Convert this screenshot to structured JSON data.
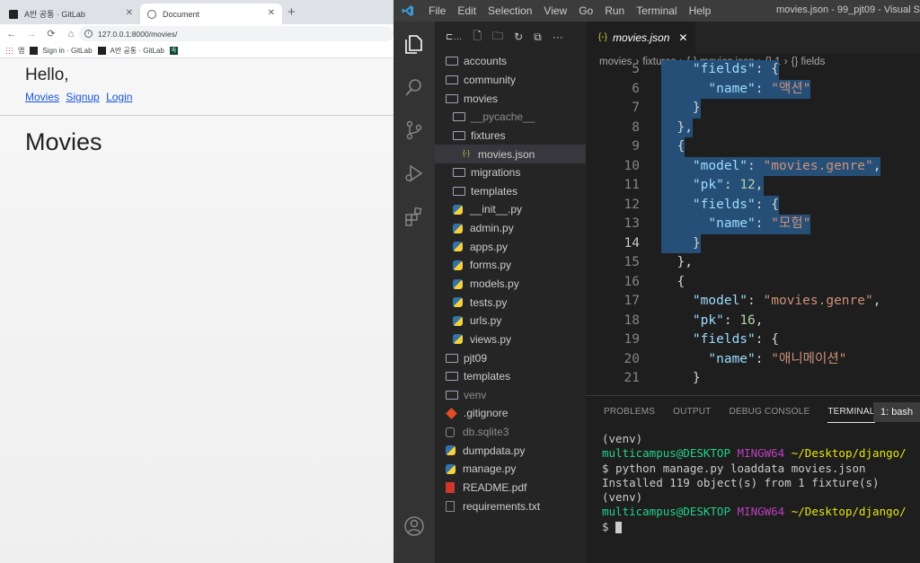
{
  "browser": {
    "tabs": [
      {
        "title": "A반 공통 · GitLab"
      },
      {
        "title": "Document"
      }
    ],
    "url": "127.0.0.1:8000/movies/",
    "bookmarks": [
      "앱",
      "Sign in · GitLab",
      "A반 공통 · GitLab",
      "dj"
    ],
    "page": {
      "greeting": "Hello,",
      "links": [
        "Movies",
        "Signup",
        "Login"
      ],
      "heading": "Movies"
    }
  },
  "vscode": {
    "menu": [
      "File",
      "Edit",
      "Selection",
      "View",
      "Go",
      "Run",
      "Terminal",
      "Help"
    ],
    "window_title": "movies.json - 99_pjt09 - Visual S",
    "explorer": [
      {
        "name": "accounts",
        "type": "folder",
        "indent": 0
      },
      {
        "name": "community",
        "type": "folder",
        "indent": 0
      },
      {
        "name": "movies",
        "type": "folder",
        "indent": 0
      },
      {
        "name": "__pycache__",
        "type": "folder",
        "indent": 1,
        "dim": true
      },
      {
        "name": "fixtures",
        "type": "folder",
        "indent": 1
      },
      {
        "name": "movies.json",
        "type": "json",
        "indent": 2,
        "selected": true
      },
      {
        "name": "migrations",
        "type": "folder",
        "indent": 1
      },
      {
        "name": "templates",
        "type": "folder",
        "indent": 1
      },
      {
        "name": "__init__.py",
        "type": "py",
        "indent": 1
      },
      {
        "name": "admin.py",
        "type": "py",
        "indent": 1
      },
      {
        "name": "apps.py",
        "type": "py",
        "indent": 1
      },
      {
        "name": "forms.py",
        "type": "py",
        "indent": 1
      },
      {
        "name": "models.py",
        "type": "py",
        "indent": 1
      },
      {
        "name": "tests.py",
        "type": "py",
        "indent": 1
      },
      {
        "name": "urls.py",
        "type": "py",
        "indent": 1
      },
      {
        "name": "views.py",
        "type": "py",
        "indent": 1
      },
      {
        "name": "pjt09",
        "type": "folder",
        "indent": 0
      },
      {
        "name": "templates",
        "type": "folder",
        "indent": 0
      },
      {
        "name": "venv",
        "type": "folder",
        "indent": 0,
        "dim": true
      },
      {
        "name": ".gitignore",
        "type": "git",
        "indent": 0
      },
      {
        "name": "db.sqlite3",
        "type": "db",
        "indent": 0,
        "dim": true
      },
      {
        "name": "dumpdata.py",
        "type": "py",
        "indent": 0
      },
      {
        "name": "manage.py",
        "type": "py",
        "indent": 0
      },
      {
        "name": "README.pdf",
        "type": "pdf",
        "indent": 0
      },
      {
        "name": "requirements.txt",
        "type": "txt",
        "indent": 0
      }
    ],
    "editor_tab": "movies.json",
    "breadcrumbs": [
      "movies",
      "fixtures",
      "{-} movies.json",
      "{} 1",
      "{} fields"
    ],
    "code_lines": [
      {
        "n": "5",
        "tokens": [
          [
            "p",
            "    "
          ],
          [
            "k",
            "\"fields\""
          ],
          [
            "p",
            ": {"
          ]
        ],
        "hl": true
      },
      {
        "n": "6",
        "tokens": [
          [
            "p",
            "      "
          ],
          [
            "k",
            "\"name\""
          ],
          [
            "p",
            ": "
          ],
          [
            "s",
            "\"액션\""
          ]
        ],
        "hl": true
      },
      {
        "n": "7",
        "tokens": [
          [
            "p",
            "    }"
          ]
        ],
        "hl": true
      },
      {
        "n": "8",
        "tokens": [
          [
            "p",
            "  },"
          ]
        ],
        "hl": true
      },
      {
        "n": "9",
        "tokens": [
          [
            "p",
            "  {"
          ]
        ],
        "hl": true
      },
      {
        "n": "10",
        "tokens": [
          [
            "p",
            "    "
          ],
          [
            "k",
            "\"model\""
          ],
          [
            "p",
            ": "
          ],
          [
            "s",
            "\"movies.genre\""
          ],
          [
            "p",
            ","
          ]
        ],
        "hl": true
      },
      {
        "n": "11",
        "tokens": [
          [
            "p",
            "    "
          ],
          [
            "k",
            "\"pk\""
          ],
          [
            "p",
            ": "
          ],
          [
            "n",
            "12"
          ],
          [
            "p",
            ","
          ]
        ],
        "hl": true
      },
      {
        "n": "12",
        "tokens": [
          [
            "p",
            "    "
          ],
          [
            "k",
            "\"fields\""
          ],
          [
            "p",
            ": {"
          ]
        ],
        "hl": true
      },
      {
        "n": "13",
        "tokens": [
          [
            "p",
            "      "
          ],
          [
            "k",
            "\"name\""
          ],
          [
            "p",
            ": "
          ],
          [
            "s",
            "\"모험\""
          ]
        ],
        "hl": true
      },
      {
        "n": "14",
        "tokens": [
          [
            "p",
            "    }"
          ]
        ],
        "hl": true,
        "current": true
      },
      {
        "n": "15",
        "tokens": [
          [
            "p",
            "  },"
          ]
        ]
      },
      {
        "n": "16",
        "tokens": [
          [
            "p",
            "  {"
          ]
        ]
      },
      {
        "n": "17",
        "tokens": [
          [
            "p",
            "    "
          ],
          [
            "k",
            "\"model\""
          ],
          [
            "p",
            ": "
          ],
          [
            "s",
            "\"movies.genre\""
          ],
          [
            "p",
            ","
          ]
        ]
      },
      {
        "n": "18",
        "tokens": [
          [
            "p",
            "    "
          ],
          [
            "k",
            "\"pk\""
          ],
          [
            "p",
            ": "
          ],
          [
            "n",
            "16"
          ],
          [
            "p",
            ","
          ]
        ]
      },
      {
        "n": "19",
        "tokens": [
          [
            "p",
            "    "
          ],
          [
            "k",
            "\"fields\""
          ],
          [
            "p",
            ": {"
          ]
        ]
      },
      {
        "n": "20",
        "tokens": [
          [
            "p",
            "      "
          ],
          [
            "k",
            "\"name\""
          ],
          [
            "p",
            ": "
          ],
          [
            "s",
            "\"애니메이션\""
          ]
        ]
      },
      {
        "n": "21",
        "tokens": [
          [
            "p",
            "    }"
          ]
        ]
      }
    ],
    "panel_tabs": [
      "PROBLEMS",
      "OUTPUT",
      "DEBUG CONSOLE",
      "TERMINAL"
    ],
    "active_panel_tab": "TERMINAL",
    "terminal_selector": "1: bash",
    "terminal": [
      [
        [
          "p",
          "(venv)"
        ]
      ],
      [
        [
          "g",
          "multicampus@DESKTOP"
        ],
        [
          "p",
          " "
        ],
        [
          "m",
          "MINGW64"
        ],
        [
          "p",
          " "
        ],
        [
          "y",
          "~/Desktop/django/"
        ]
      ],
      [
        [
          "p",
          "$ python manage.py loaddata movies.json"
        ]
      ],
      [
        [
          "p",
          "Installed 119 object(s) from 1 fixture(s)"
        ]
      ],
      [
        [
          "p",
          "(venv)"
        ]
      ],
      [
        [
          "g",
          "multicampus@DESKTOP"
        ],
        [
          "p",
          " "
        ],
        [
          "m",
          "MINGW64"
        ],
        [
          "p",
          " "
        ],
        [
          "y",
          "~/Desktop/django/"
        ]
      ],
      [
        [
          "p",
          "$ "
        ]
      ]
    ]
  }
}
